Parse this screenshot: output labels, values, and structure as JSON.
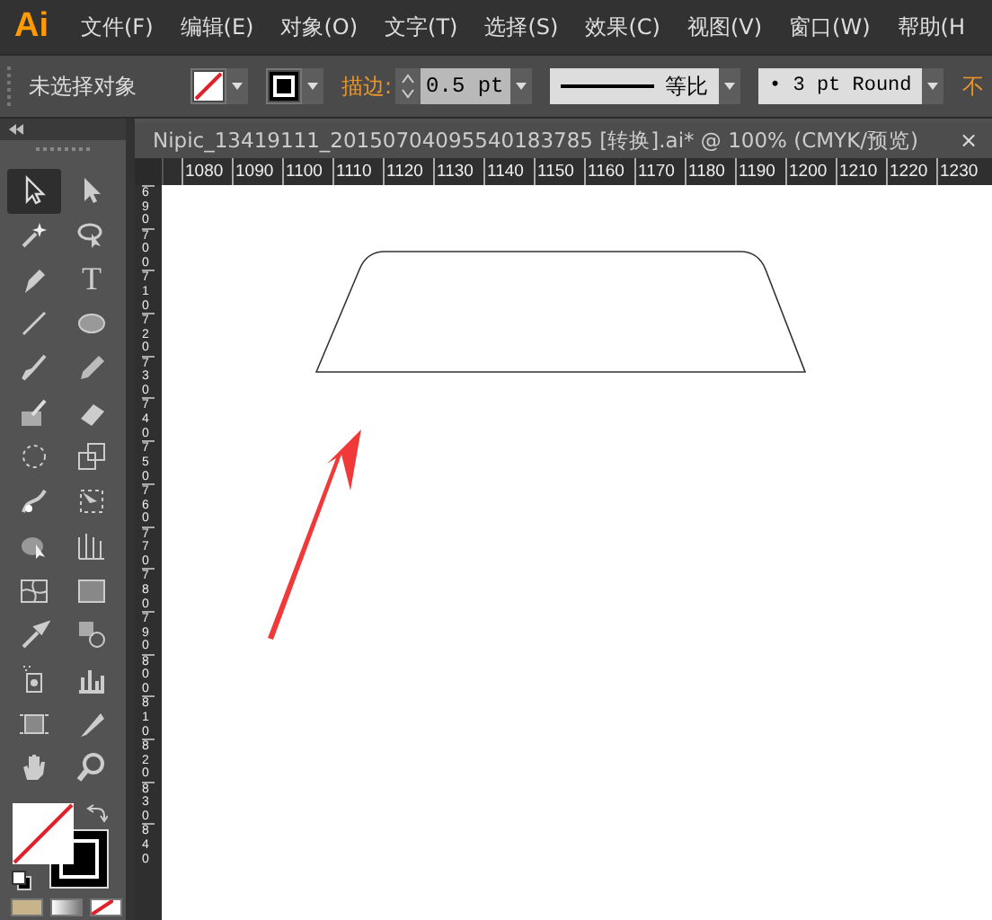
{
  "menu_bar": {
    "logo": "Ai",
    "items": [
      "文件(F)",
      "编辑(E)",
      "对象(O)",
      "文字(T)",
      "选择(S)",
      "效果(C)",
      "视图(V)",
      "窗口(W)",
      "帮助(H"
    ]
  },
  "control_bar": {
    "selection": "未选择对象",
    "stroke_label": "描边:",
    "stroke_weight": "0.5 pt",
    "stroke_profile": "等比",
    "brush": "• 3 pt Round",
    "opacity_label": "不"
  },
  "document_tab": {
    "title": "Nipic_13419111_20150704095540183785  [转换].ai* @ 100% (CMYK/预览)",
    "close": "×"
  },
  "horizontal_ruler": [
    "1080",
    "1090",
    "1100",
    "1110",
    "1120",
    "1130",
    "1140",
    "1150",
    "1160",
    "1170",
    "1180",
    "1190",
    "1200",
    "1210",
    "1220",
    "1230"
  ],
  "vertical_ruler": [
    "690",
    "700",
    "710",
    "720",
    "730",
    "740",
    "750",
    "760",
    "770",
    "780",
    "790",
    "800",
    "810",
    "820",
    "830",
    "840"
  ],
  "tools": [
    {
      "kind": "select",
      "selected": true
    },
    {
      "kind": "direct-select",
      "selected": false
    },
    {
      "kind": "wand",
      "selected": false
    },
    {
      "kind": "lasso",
      "selected": false
    },
    {
      "kind": "pen",
      "selected": false
    },
    {
      "kind": "type",
      "label": "T",
      "selected": false
    },
    {
      "kind": "line",
      "selected": false
    },
    {
      "kind": "ellipse",
      "selected": false
    },
    {
      "kind": "brush",
      "selected": false
    },
    {
      "kind": "pencil",
      "selected": false
    },
    {
      "kind": "blob",
      "selected": false
    },
    {
      "kind": "eraser",
      "selected": false
    },
    {
      "kind": "rotate",
      "selected": false
    },
    {
      "kind": "scale",
      "selected": false
    },
    {
      "kind": "warp",
      "selected": false
    },
    {
      "kind": "transform",
      "selected": false
    },
    {
      "kind": "builder",
      "selected": false
    },
    {
      "kind": "perspective",
      "selected": false
    },
    {
      "kind": "mesh",
      "selected": false
    },
    {
      "kind": "gradient",
      "selected": false
    },
    {
      "kind": "eyedropper",
      "selected": false
    },
    {
      "kind": "blend",
      "selected": false
    },
    {
      "kind": "sprayer",
      "selected": false
    },
    {
      "kind": "graph",
      "selected": false
    },
    {
      "kind": "artboard",
      "selected": false
    },
    {
      "kind": "knife",
      "selected": false
    },
    {
      "kind": "hand",
      "selected": false
    },
    {
      "kind": "zoom",
      "selected": false
    }
  ]
}
